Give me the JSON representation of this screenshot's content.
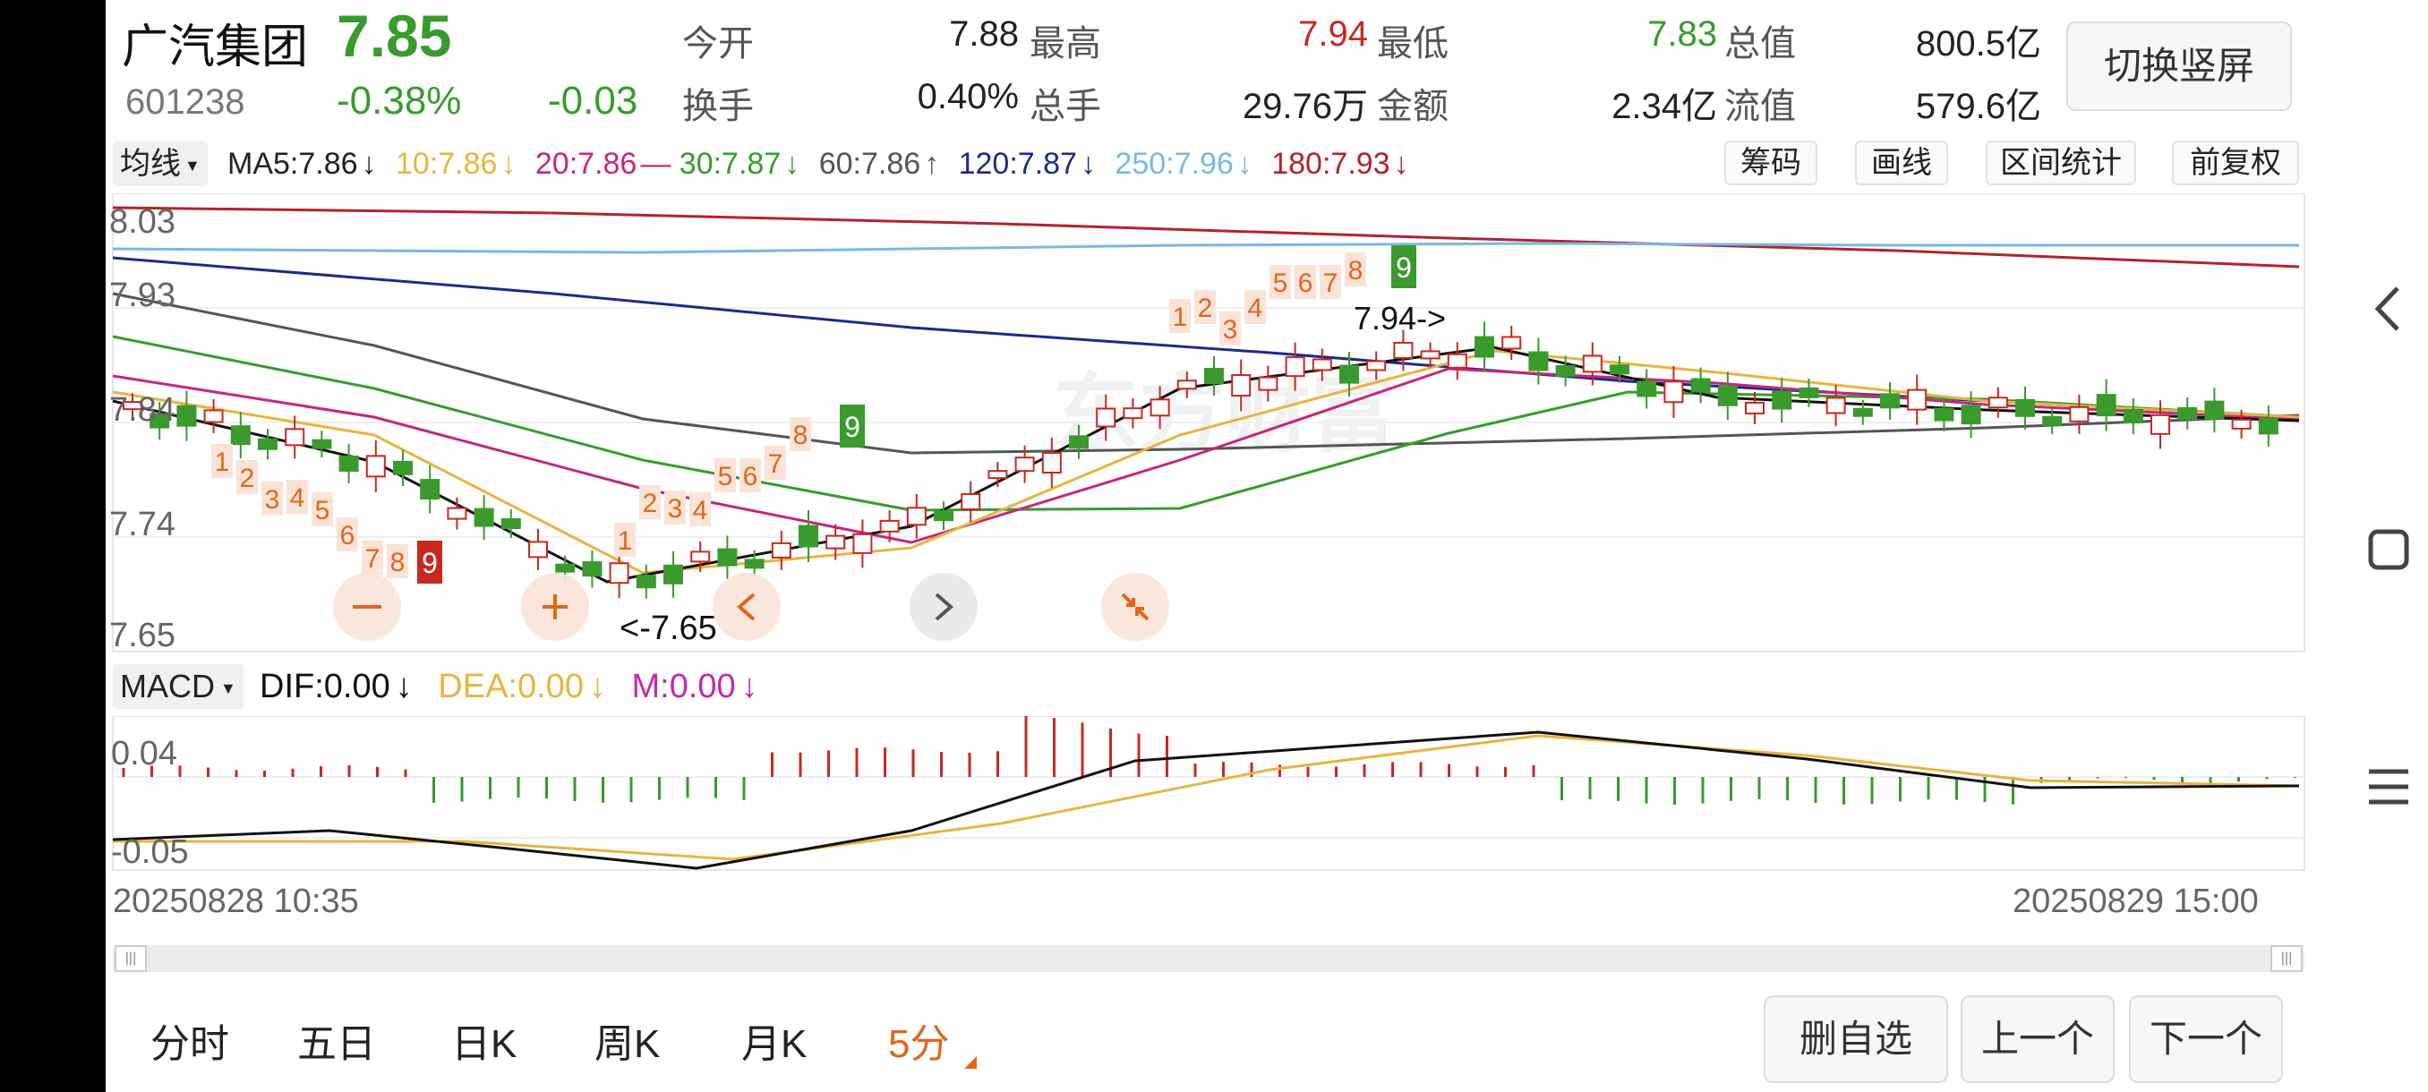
{
  "stock": {
    "name": "广汽集团",
    "price": "7.85",
    "code": "601238",
    "change_pct": "-0.38%",
    "change": "-0.03"
  },
  "quote": {
    "open_label": "今开",
    "open": "7.88",
    "high_label": "最高",
    "high": "7.94",
    "low_label": "最低",
    "low": "7.83",
    "mktcap_label": "总值",
    "mktcap": "800.5亿",
    "turnover_label": "换手",
    "turnover": "0.40%",
    "volume_label": "总手",
    "volume": "29.76万",
    "amount_label": "金额",
    "amount": "2.34亿",
    "float_label": "流值",
    "float_cap": "579.6亿"
  },
  "switch_btn": "切换竖屏",
  "ma_bar": {
    "selector": "均线",
    "ma5": "MA5:7.86",
    "ma10": "10:7.86",
    "ma20": "20:7.86",
    "ma30": "30:7.87",
    "ma60": "60:7.86",
    "ma120": "120:7.87",
    "ma250": "250:7.96",
    "ma180": "180:7.93",
    "arrows": {
      "ma5": "↓",
      "ma10": "↓",
      "ma20": "—",
      "ma30": "↓",
      "ma60": "↑",
      "ma120": "↓",
      "ma250": "↓",
      "ma180": "↓"
    }
  },
  "tools": [
    "筹码",
    "画线",
    "区间统计",
    "前复权"
  ],
  "price_axis": [
    "8.03",
    "7.93",
    "7.84",
    "7.74",
    "7.65"
  ],
  "annotations": {
    "low": "<-7.65",
    "high": "7.94->"
  },
  "td_sequence": [
    "1",
    "2",
    "3",
    "4",
    "5",
    "6",
    "7",
    "8",
    "9"
  ],
  "macd_bar": {
    "selector": "MACD",
    "dif": "DIF:0.00",
    "dea": "DEA:0.00",
    "m": "M:0.00",
    "arrows": {
      "dif": "↓",
      "dea": "↓",
      "m": "↓"
    }
  },
  "macd_axis": [
    "0.04",
    "-0.05"
  ],
  "time_axis": {
    "start": "20250828 10:35",
    "end": "20250829 15:00"
  },
  "period_tabs": [
    "分时",
    "五日",
    "日K",
    "周K",
    "月K",
    "5分"
  ],
  "active_period": "5分",
  "actions": [
    "删自选",
    "上一个",
    "下一个"
  ],
  "colors": {
    "up": "#c8281e",
    "down": "#3a9a2e",
    "active_tab": "#e0661c",
    "ma5": "#111111",
    "ma10": "#e8b440",
    "ma20": "#c4287a",
    "ma30": "#3a9a2e",
    "ma60": "#555555",
    "ma120": "#1b2a8c",
    "ma250": "#7ab8e6",
    "ma180": "#b0242a"
  },
  "chart_data": {
    "type": "candlestick",
    "interval": "5分",
    "y_range": [
      7.63,
      8.05
    ],
    "x_range": [
      "20250828 10:35",
      "20250829 15:00"
    ],
    "watermark": "东方财富"
  }
}
